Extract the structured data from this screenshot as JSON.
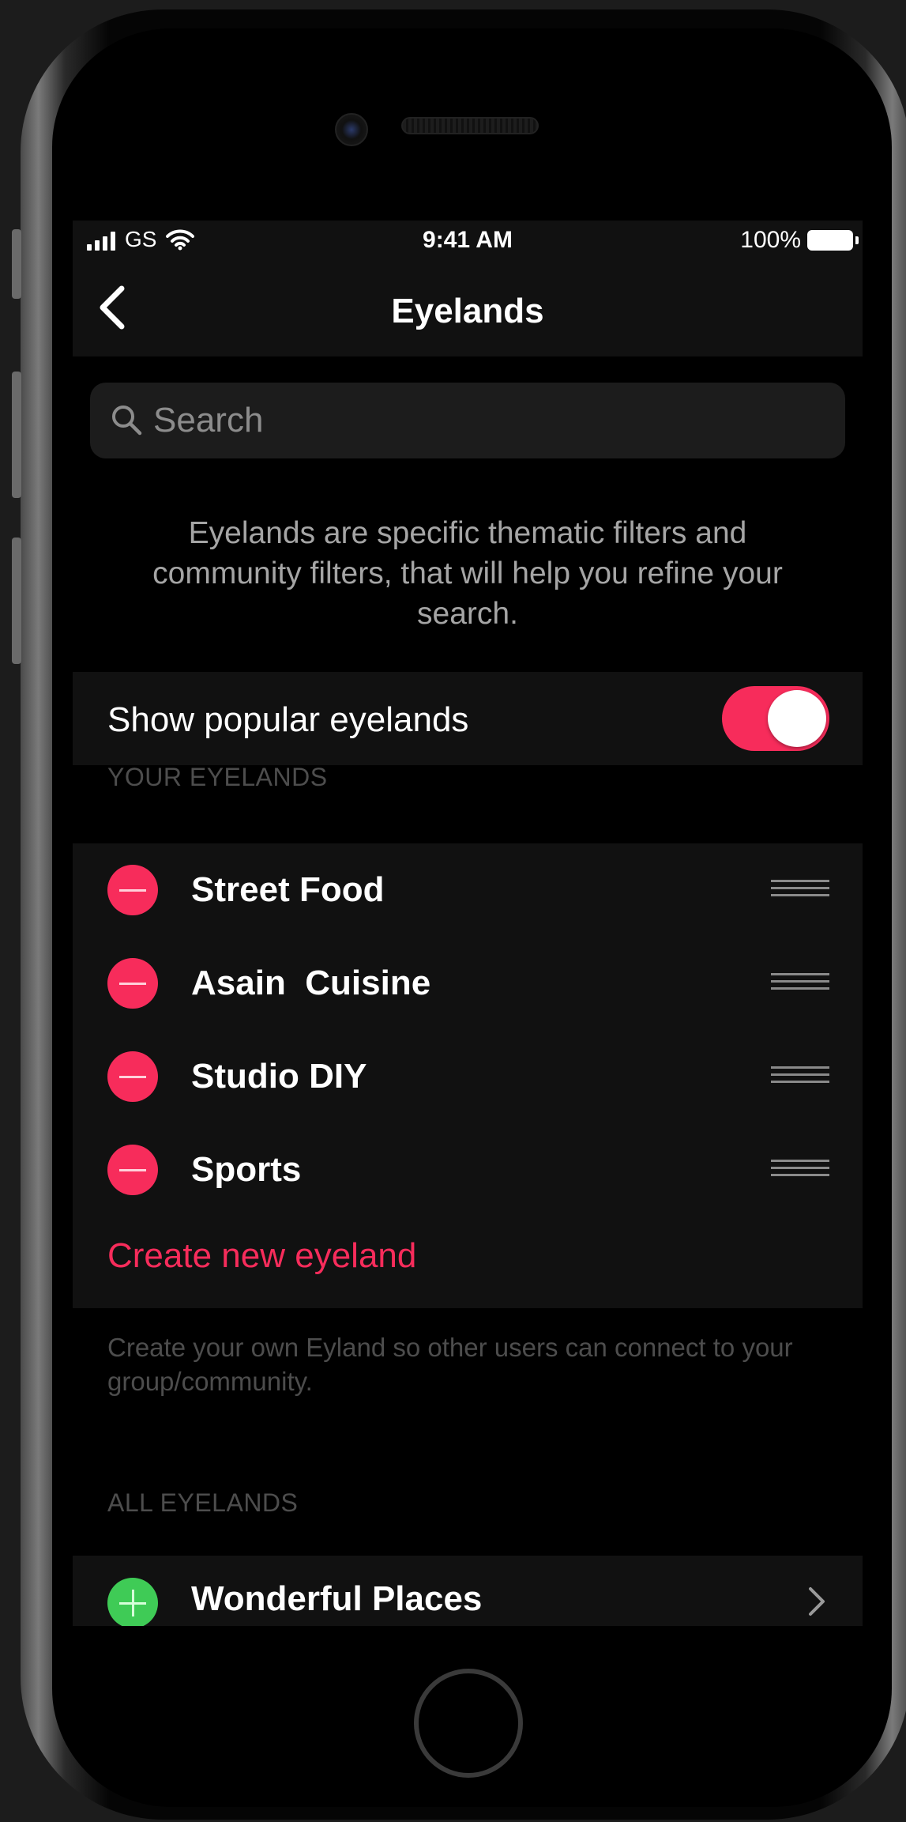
{
  "status_bar": {
    "carrier": "GS",
    "time": "9:41 AM",
    "battery": "100%"
  },
  "nav": {
    "title": "Eyelands",
    "back_icon": "chevron-left-icon"
  },
  "search": {
    "placeholder": "Search",
    "value": "",
    "icon": "search-icon"
  },
  "intro_text": "Eyelands are specific thematic filters and community filters, that will help you refine your search.",
  "toggle": {
    "label": "Show popular eyelands",
    "on": true
  },
  "your_eyelands": {
    "header": "YOUR EYELANDS",
    "items": [
      {
        "label": "Street Food"
      },
      {
        "label": "Asain  Cuisine"
      },
      {
        "label": "Studio DIY"
      },
      {
        "label": "Sports"
      }
    ],
    "create_label": "Create new eyeland",
    "footnote": "Create your own Eyland so other users can connect to your group/community."
  },
  "all_eyelands": {
    "header": "ALL EYELANDS",
    "items": [
      {
        "label": "Wonderful Places"
      }
    ]
  },
  "colors": {
    "accent": "#f72c5b",
    "add": "#3fcb56",
    "background": "#000000",
    "cell": "#111111"
  }
}
